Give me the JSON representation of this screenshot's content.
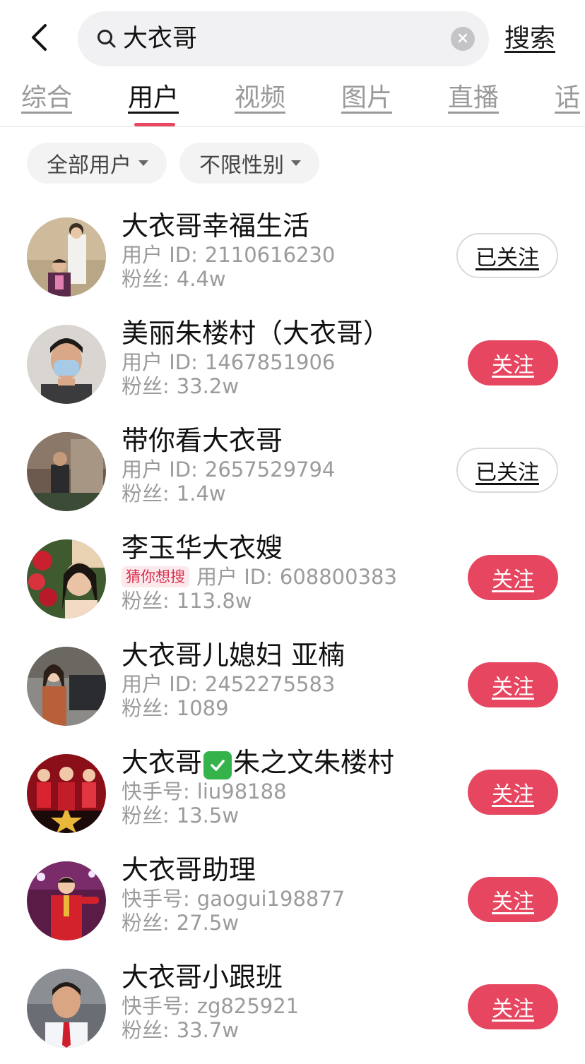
{
  "header": {
    "search_query": "大衣哥",
    "search_button": "搜索"
  },
  "tabs": [
    {
      "label": "综合",
      "active": false
    },
    {
      "label": "用户",
      "active": true
    },
    {
      "label": "视频",
      "active": false
    },
    {
      "label": "图片",
      "active": false
    },
    {
      "label": "直播",
      "active": false
    },
    {
      "label": "话",
      "active": false
    }
  ],
  "filters": [
    {
      "label": "全部用户"
    },
    {
      "label": "不限性别"
    }
  ],
  "users": [
    {
      "name": "大衣哥幸福生活",
      "id_label": "用户 ID:",
      "id_value": "2110616230",
      "fans_label": "粉丝:",
      "fans": "4.4w",
      "button": "已关注",
      "following": true
    },
    {
      "name": "美丽朱楼村（大衣哥）",
      "id_label": "用户 ID:",
      "id_value": "1467851906",
      "fans_label": "粉丝:",
      "fans": "33.2w",
      "button": "关注",
      "following": false
    },
    {
      "name": "带你看大衣哥",
      "id_label": "用户 ID:",
      "id_value": "2657529794",
      "fans_label": "粉丝:",
      "fans": "1.4w",
      "button": "已关注",
      "following": true
    },
    {
      "name": "李玉华大衣嫂",
      "tag": "猜你想搜",
      "id_label": "用户 ID:",
      "id_value": "608800383",
      "fans_label": "粉丝:",
      "fans": "113.8w",
      "button": "关注",
      "following": false
    },
    {
      "name": "大衣哥儿媳妇 亚楠",
      "id_label": "用户 ID:",
      "id_value": "2452275583",
      "fans_label": "粉丝:",
      "fans": "1089",
      "button": "关注",
      "following": false
    },
    {
      "name_before": "大衣哥",
      "name_after": "朱之文朱楼村",
      "id_label": "快手号:",
      "id_value": "liu98188",
      "fans_label": "粉丝:",
      "fans": "13.5w",
      "button": "关注",
      "following": false
    },
    {
      "name": "大衣哥助理",
      "id_label": "快手号:",
      "id_value": "gaogui198877",
      "fans_label": "粉丝:",
      "fans": "27.5w",
      "button": "关注",
      "following": false
    },
    {
      "name": "大衣哥小跟班",
      "id_label": "快手号:",
      "id_value": "zg825921",
      "fans_label": "粉丝:",
      "fans": "33.7w",
      "button": "关注",
      "following": false
    }
  ],
  "colors": {
    "accent": "#e6465f",
    "tag_bg": "#fde8ec",
    "verified_green": "#35b34a"
  }
}
